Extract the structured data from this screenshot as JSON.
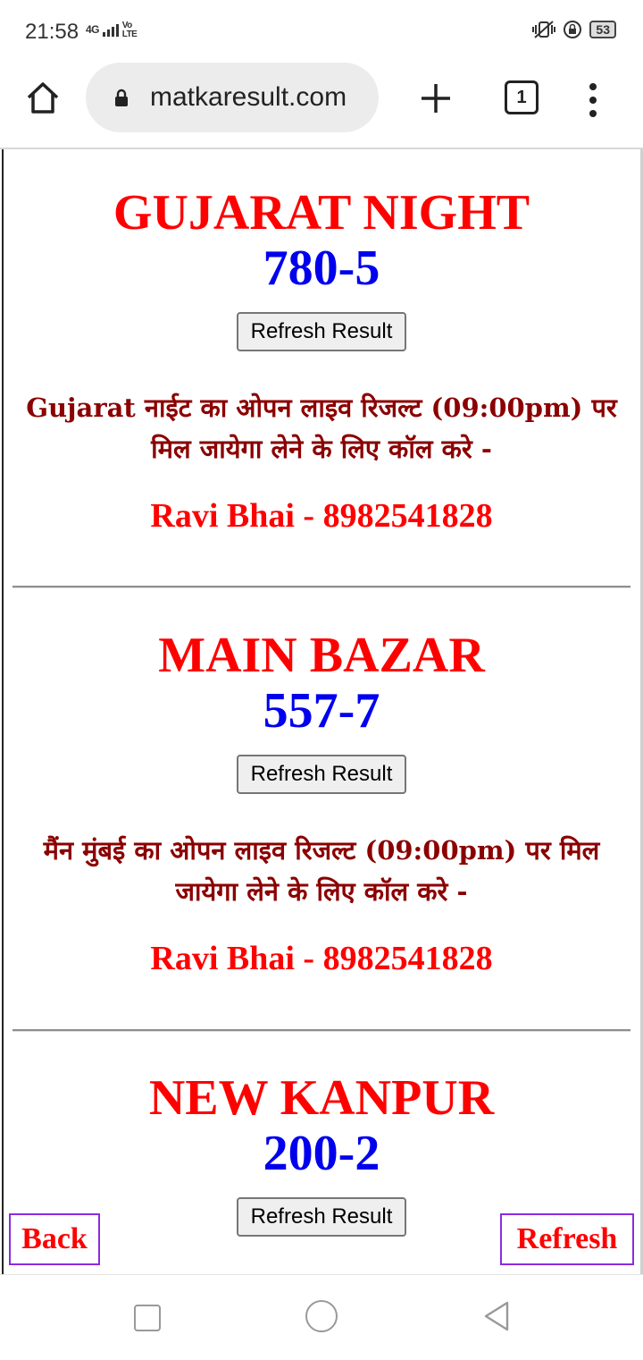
{
  "status_bar": {
    "time": "21:58",
    "network": "4G",
    "carrier_badge": "Vo LTE",
    "battery": "53"
  },
  "browser": {
    "url": "matkaresult.com",
    "tab_count": "1"
  },
  "markets": [
    {
      "name": "GUJARAT NIGHT",
      "result": "780-5",
      "button_label": "Refresh Result",
      "info": "Gujarat नाईट का ओपन लाइव रिजल्ट (09:00pm) पर मिल जायेगा लेने के लिए कॉल करे -",
      "contact": "Ravi Bhai - 8982541828"
    },
    {
      "name": "MAIN BAZAR",
      "result": "557-7",
      "button_label": "Refresh Result",
      "info": "मैंन मुंबई का ओपन लाइव रिजल्ट (09:00pm) पर मिल जायेगा लेने के लिए कॉल करे -",
      "contact": "Ravi Bhai - 8982541828"
    },
    {
      "name": "NEW KANPUR",
      "result": "200-2",
      "button_label": "Refresh Result"
    }
  ],
  "floating": {
    "back_label": "Back",
    "refresh_label": "Refresh"
  },
  "colors": {
    "market_name": "#ff0000",
    "result": "#0000ee",
    "info_text": "#8b0000",
    "floating_border": "#8a2be2"
  }
}
